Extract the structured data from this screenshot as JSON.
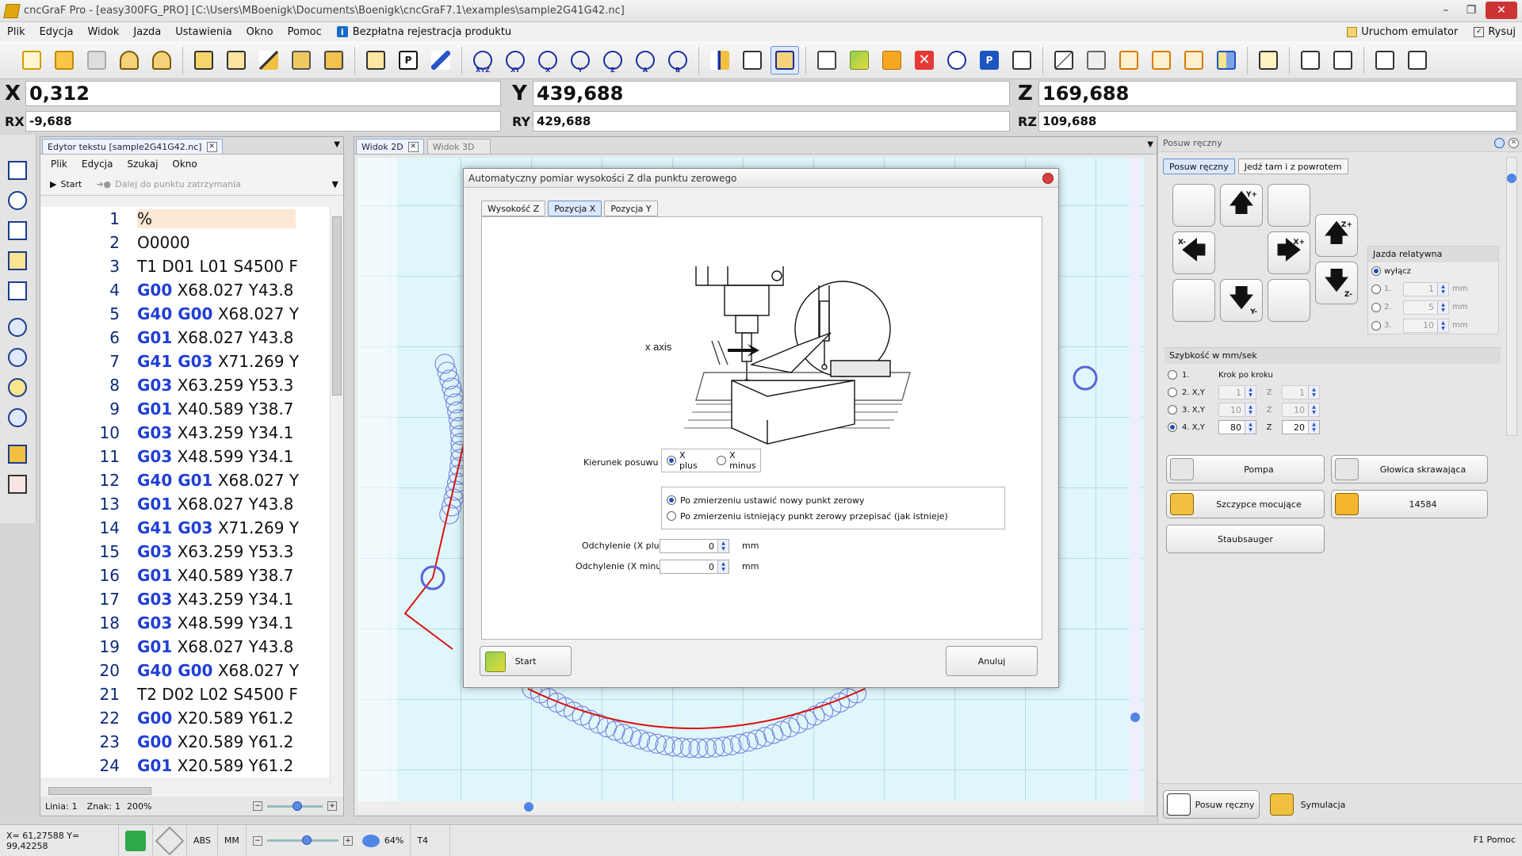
{
  "window": {
    "title": "cncGraF Pro - [easy300FG_PRO] [C:\\Users\\MBoenigk\\Documents\\Boenigk\\cncGraF7.1\\examples\\sample2G41G42.nc]"
  },
  "menu": {
    "items": [
      "Plik",
      "Edycja",
      "Widok",
      "Jazda",
      "Ustawienia",
      "Okno",
      "Pomoc"
    ],
    "register": "Bezpłatna rejestracja produktu",
    "emulator": "Uruchom emulator",
    "draw": "Rysuj"
  },
  "toolbar": {
    "axis_labels": [
      "XYZ",
      "XY",
      "X",
      "Y",
      "Z",
      "A",
      "B"
    ]
  },
  "coords": {
    "x_label": "X",
    "x": "0,312",
    "y_label": "Y",
    "y": "439,688",
    "z_label": "Z",
    "z": "169,688",
    "rx_label": "RX",
    "rx": "-9,688",
    "ry_label": "RY",
    "ry": "429,688",
    "rz_label": "RZ",
    "rz": "109,688"
  },
  "editor": {
    "tab": "Edytor tekstu [sample2G41G42.nc]",
    "menu": [
      "Plik",
      "Edycja",
      "Szukaj",
      "Okno"
    ],
    "start": "Start",
    "continue": "Dalej do punktu zatrzymania",
    "lines": [
      {
        "n": "1",
        "parts": [
          {
            "t": "%"
          }
        ]
      },
      {
        "n": "2",
        "parts": [
          {
            "t": "O0000"
          }
        ]
      },
      {
        "n": "3",
        "parts": [
          {
            "t": " T1 D01 L01 S4500 F"
          }
        ]
      },
      {
        "n": "4",
        "parts": [
          {
            "t": " G00",
            "k": true
          },
          {
            "t": " X68.027 Y43.8"
          }
        ]
      },
      {
        "n": "5",
        "parts": [
          {
            "t": " G40 G00",
            "k": true
          },
          {
            "t": " X68.027 Y"
          }
        ]
      },
      {
        "n": "6",
        "parts": [
          {
            "t": " G01",
            "k": true
          },
          {
            "t": " X68.027 Y43.8"
          }
        ]
      },
      {
        "n": "7",
        "parts": [
          {
            "t": " G41 G03",
            "k": true
          },
          {
            "t": " X71.269 Y"
          }
        ]
      },
      {
        "n": "8",
        "parts": [
          {
            "t": " G03",
            "k": true
          },
          {
            "t": " X63.259 Y53.3"
          }
        ]
      },
      {
        "n": "9",
        "parts": [
          {
            "t": " G01",
            "k": true
          },
          {
            "t": " X40.589 Y38.7"
          }
        ]
      },
      {
        "n": "10",
        "parts": [
          {
            "t": " G03",
            "k": true
          },
          {
            "t": " X43.259 Y34.1"
          }
        ]
      },
      {
        "n": "11",
        "parts": [
          {
            "t": " G03",
            "k": true
          },
          {
            "t": " X48.599 Y34.1"
          }
        ]
      },
      {
        "n": "12",
        "parts": [
          {
            "t": " G40 G01",
            "k": true
          },
          {
            "t": " X68.027 Y"
          }
        ]
      },
      {
        "n": "13",
        "parts": [
          {
            "t": " G01",
            "k": true
          },
          {
            "t": " X68.027 Y43.8"
          }
        ]
      },
      {
        "n": "14",
        "parts": [
          {
            "t": " G41 G03",
            "k": true
          },
          {
            "t": " X71.269 Y"
          }
        ]
      },
      {
        "n": "15",
        "parts": [
          {
            "t": " G03",
            "k": true
          },
          {
            "t": " X63.259 Y53.3"
          }
        ]
      },
      {
        "n": "16",
        "parts": [
          {
            "t": " G01",
            "k": true
          },
          {
            "t": " X40.589 Y38.7"
          }
        ]
      },
      {
        "n": "17",
        "parts": [
          {
            "t": " G03",
            "k": true
          },
          {
            "t": " X43.259 Y34.1"
          }
        ]
      },
      {
        "n": "18",
        "parts": [
          {
            "t": " G03",
            "k": true
          },
          {
            "t": " X48.599 Y34.1"
          }
        ]
      },
      {
        "n": "19",
        "parts": [
          {
            "t": " G01",
            "k": true
          },
          {
            "t": " X68.027 Y43.8"
          }
        ]
      },
      {
        "n": "20",
        "parts": [
          {
            "t": " G40 G00",
            "k": true
          },
          {
            "t": " X68.027 Y"
          }
        ]
      },
      {
        "n": "21",
        "parts": [
          {
            "t": " T2 D02 L02 S4500 F"
          }
        ]
      },
      {
        "n": "22",
        "parts": [
          {
            "t": " G00",
            "k": true
          },
          {
            "t": " X20.589 Y61.2"
          }
        ]
      },
      {
        "n": "23",
        "parts": [
          {
            "t": " G00",
            "k": true
          },
          {
            "t": " X20.589 Y61.2"
          }
        ]
      },
      {
        "n": "24",
        "parts": [
          {
            "t": " G01",
            "k": true
          },
          {
            "t": " X20.589 Y61.2"
          }
        ]
      }
    ],
    "status": {
      "line_label": "Linia:",
      "line": "1",
      "chars_label": "Znak:",
      "chars": "1",
      "zoom": "200%"
    }
  },
  "view": {
    "tab_2d": "Widok 2D",
    "tab_3d": "Widok 3D"
  },
  "dialog": {
    "title": "Automatyczny pomiar wysokości Z dla punktu zerowego",
    "tabs": [
      "Wysokość Z",
      "Pozycja X",
      "Pozycja Y"
    ],
    "active_tab": "Pozycja X",
    "diagram_label": "x axis",
    "direction_label": "Kierunek posuwu",
    "dir_plus": "X plus",
    "dir_minus": "X minus",
    "opt_set_new": "Po zmierzeniu ustawić nowy punkt zerowy",
    "opt_overwrite": "Po zmierzeniu istniejący punkt zerowy przepisać (jak istnieje)",
    "offset_plus_label": "Odchylenie (X plus)",
    "offset_plus": "0",
    "offset_minus_label": "Odchylenie (X minus)",
    "offset_minus": "0",
    "unit": "mm",
    "start": "Start",
    "cancel": "Anuluj"
  },
  "right_panel": {
    "title": "Posuw ręczny",
    "tab_manual": "Posuw ręczny",
    "tab_there_back": "Jedź tam i z powrotem",
    "relative_title": "Jazda relatywna",
    "relative_off": "wyłącz",
    "relative_rows": [
      {
        "label": "1.",
        "value": "1",
        "unit": "mm"
      },
      {
        "label": "2.",
        "value": "5",
        "unit": "mm"
      },
      {
        "label": "3.",
        "value": "10",
        "unit": "mm"
      }
    ],
    "speed_title": "Szybkość w mm/sek",
    "step_label": "Krok po kroku",
    "speed_rows": [
      {
        "label": "1.",
        "xy": "",
        "z": ""
      },
      {
        "label": "2. X,Y",
        "xy": "1",
        "z": "1"
      },
      {
        "label": "3. X,Y",
        "xy": "10",
        "z": "10"
      },
      {
        "label": "4. X,Y",
        "xy": "80",
        "z": "20"
      }
    ],
    "z_label": "Z",
    "pump": "Pompa",
    "cutter_head": "Głowica skrawająca",
    "clamps": "Szczypce mocujące",
    "counter": "14584",
    "vacuum": "Staubsauger",
    "bottom_manual": "Posuw ręczny",
    "bottom_sim": "Symulacja"
  },
  "status": {
    "pos": "X= 61,27588 Y= 99,42258",
    "abs": "ABS",
    "mm": "MM",
    "zoom": "64%",
    "tool": "T4",
    "help": "F1 Pomoc"
  },
  "colors": {
    "toolpath": "#dd1111",
    "tool_circle": "#5a63d8",
    "accent": "#1f3fd6",
    "canvas": "#dff7fb"
  }
}
